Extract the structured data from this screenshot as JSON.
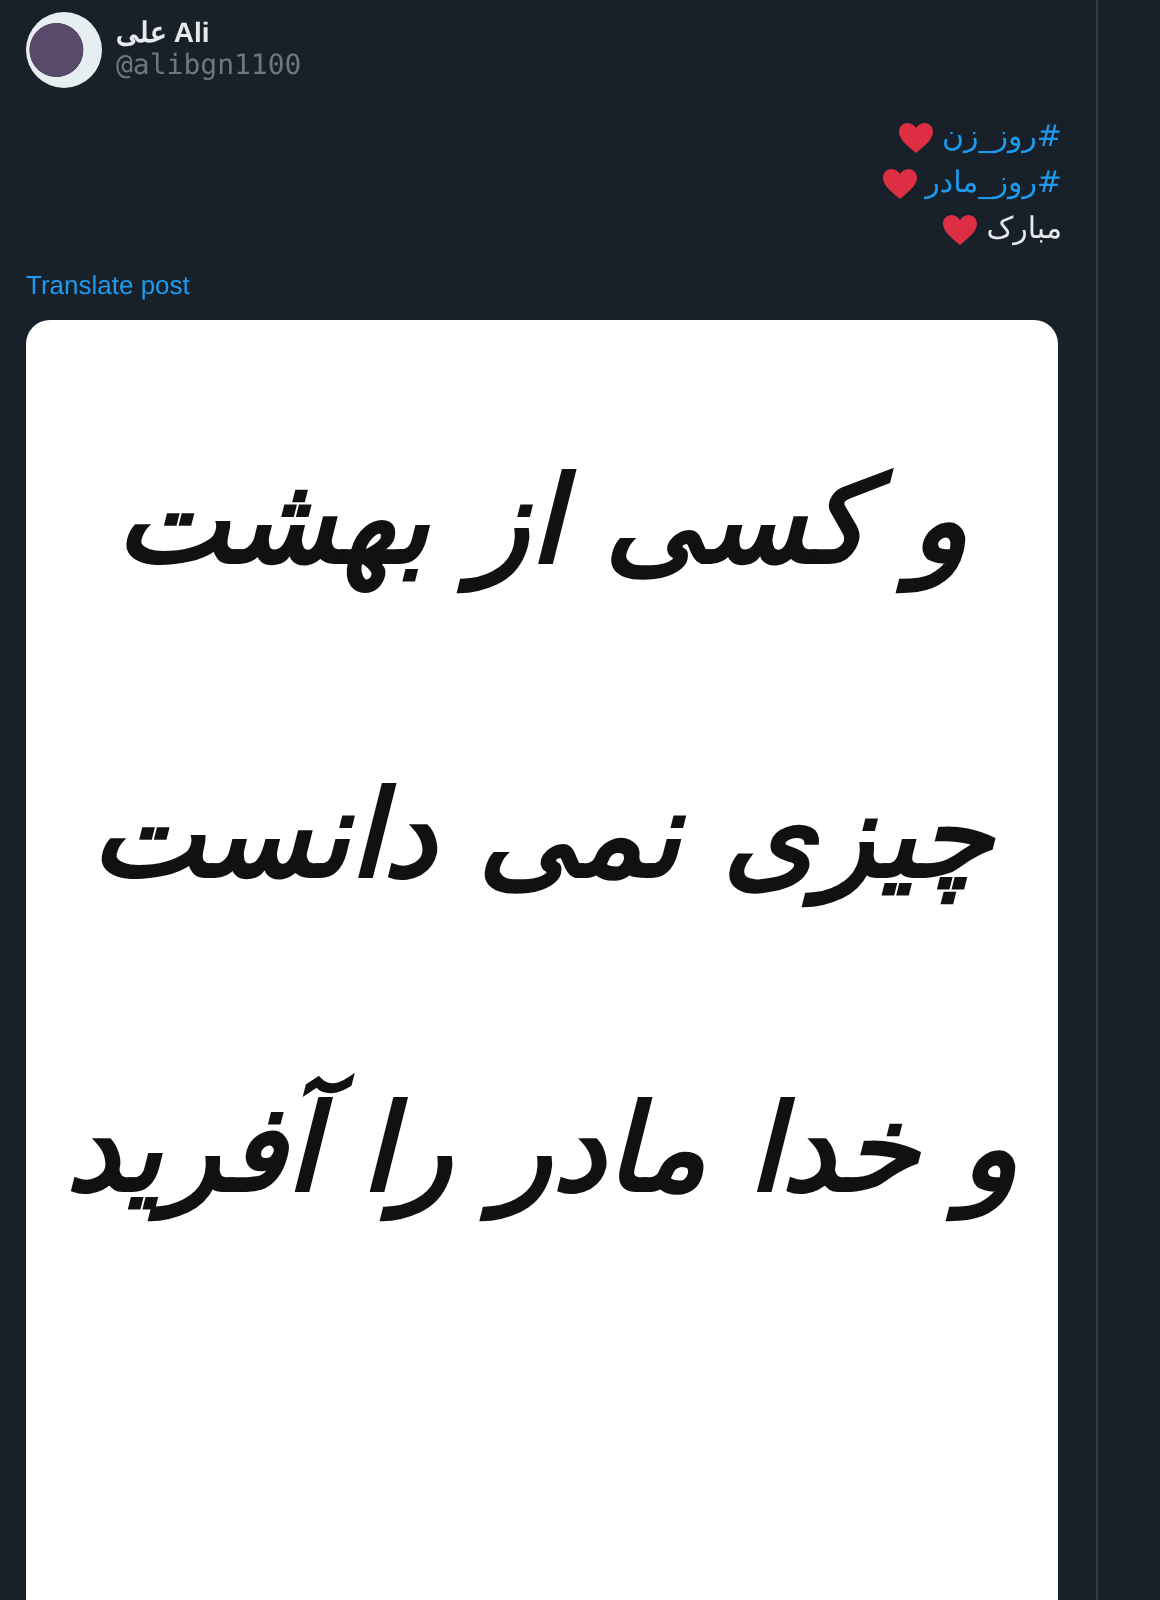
{
  "author": {
    "name": "علی Ali",
    "handle": "@alibgn1100"
  },
  "post_lines": [
    {
      "kind": "hashtag",
      "text": "#روز_زن"
    },
    {
      "kind": "hashtag",
      "text": "#روز_مادر"
    },
    {
      "kind": "plain",
      "text": "مبارک"
    }
  ],
  "translate_link": "Translate post",
  "image": {
    "lines": [
      "و کسی از بهشت",
      "چیزی نمی دانست",
      "و خدا مادر را آفرید"
    ]
  }
}
